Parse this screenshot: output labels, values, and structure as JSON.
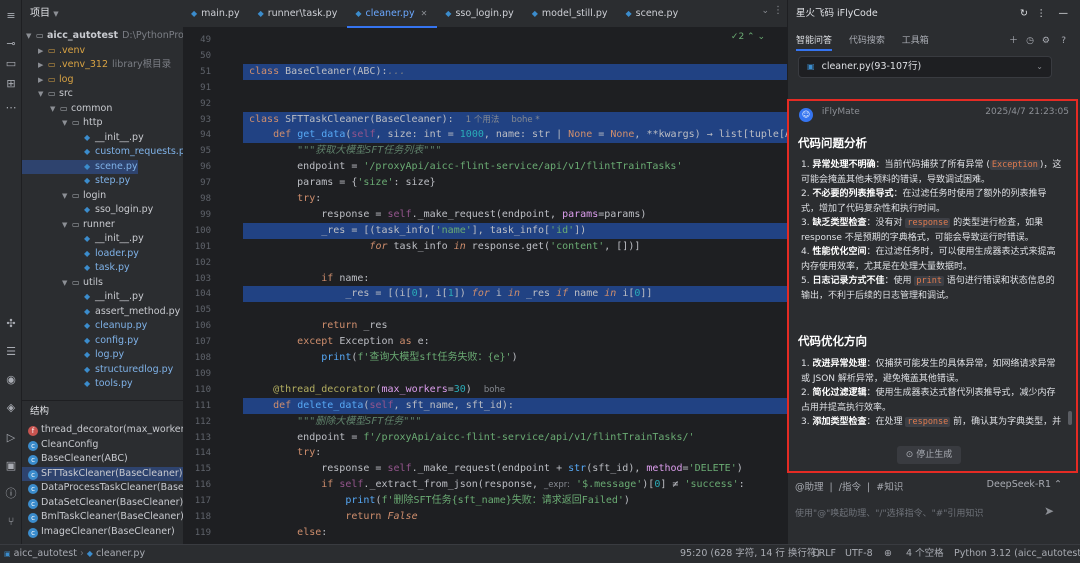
{
  "project": {
    "title": "项目",
    "tree": [
      {
        "label": "aicc_autotest",
        "extra": "D:\\PythonProje",
        "kind": "folder",
        "depth": 0,
        "open": true
      },
      {
        "label": ".venv",
        "kind": "folder",
        "depth": 1,
        "open": false
      },
      {
        "label": ".venv_312",
        "extra": "library根目录",
        "kind": "folder",
        "depth": 1,
        "open": false
      },
      {
        "label": "log",
        "kind": "folder",
        "depth": 1,
        "open": false
      },
      {
        "label": "src",
        "kind": "folder",
        "depth": 1,
        "open": true
      },
      {
        "label": "common",
        "kind": "folder",
        "depth": 2,
        "open": true
      },
      {
        "label": "http",
        "kind": "folder",
        "depth": 3,
        "open": true
      },
      {
        "label": "__init__.py",
        "kind": "py",
        "depth": 4
      },
      {
        "label": "custom_requests.p",
        "kind": "py",
        "depth": 4
      },
      {
        "label": "scene.py",
        "kind": "py",
        "depth": 4
      },
      {
        "label": "step.py",
        "kind": "py",
        "depth": 4
      },
      {
        "label": "login",
        "kind": "folder",
        "depth": 3,
        "open": true
      },
      {
        "label": "sso_login.py",
        "kind": "py",
        "depth": 4
      },
      {
        "label": "runner",
        "kind": "folder",
        "depth": 3,
        "open": true
      },
      {
        "label": "__init__.py",
        "kind": "py",
        "depth": 4
      },
      {
        "label": "loader.py",
        "kind": "py",
        "depth": 4
      },
      {
        "label": "task.py",
        "kind": "py",
        "depth": 4
      },
      {
        "label": "utils",
        "kind": "folder",
        "depth": 3,
        "open": true
      },
      {
        "label": "__init__.py",
        "kind": "py",
        "depth": 4
      },
      {
        "label": "assert_method.py",
        "kind": "py",
        "depth": 4
      },
      {
        "label": "cleanup.py",
        "kind": "py",
        "depth": 4
      },
      {
        "label": "config.py",
        "kind": "py",
        "depth": 4
      },
      {
        "label": "log.py",
        "kind": "py",
        "depth": 4
      },
      {
        "label": "structuredlog.py",
        "kind": "py",
        "depth": 4
      },
      {
        "label": "tools.py",
        "kind": "py",
        "depth": 4
      }
    ]
  },
  "structure": {
    "title": "结构",
    "items": [
      {
        "label": "thread_decorator(max_worker",
        "kind": "f",
        "color": "#c75450"
      },
      {
        "label": "CleanConfig",
        "kind": "c",
        "color": "#3b8ccc"
      },
      {
        "label": "BaseCleaner(ABC)",
        "kind": "c",
        "color": "#3b8ccc"
      },
      {
        "label": "SFTTaskCleaner(BaseCleaner)",
        "kind": "c",
        "color": "#3b8ccc",
        "selected": true
      },
      {
        "label": "DataProcessTaskCleaner(BaseC",
        "kind": "c",
        "color": "#3b8ccc"
      },
      {
        "label": "DataSetCleaner(BaseCleaner)",
        "kind": "c",
        "color": "#3b8ccc"
      },
      {
        "label": "BmlTaskCleaner(BaseCleaner)",
        "kind": "c",
        "color": "#3b8ccc"
      },
      {
        "label": "ImageCleaner(BaseCleaner)",
        "kind": "c",
        "color": "#3b8ccc"
      }
    ]
  },
  "tabs": [
    {
      "label": "main.py",
      "active": false
    },
    {
      "label": "runner\\task.py",
      "active": false
    },
    {
      "label": "cleaner.py",
      "active": true
    },
    {
      "label": "sso_login.py",
      "active": false
    },
    {
      "label": "model_still.py",
      "active": false
    },
    {
      "label": "scene.py",
      "active": false
    }
  ],
  "editor": {
    "inspection": "2",
    "hint_usages": "1 个用法",
    "hint_author": "bohe *",
    "hint_author2": "bohe"
  },
  "ai": {
    "title": "星火飞码 iFlyCode",
    "tabs": [
      "智能问答",
      "代码搜索",
      "工具箱"
    ],
    "context_file": "cleaner.py(93-107行)",
    "bot_name": "iFlyMate",
    "timestamp": "2025/4/7 21:23:05",
    "section1": "代码问题分析",
    "analysis": [
      {
        "title": "异常处理不明确",
        "pre": "：当前代码捕获了所有异常 (",
        "code": "Exception",
        "post": ")，这可能会掩盖其他未预料的错误，导致调试困难。"
      },
      {
        "title": "不必要的列表推导式",
        "pre": "：在过滤任务时使用了额外的列表推导式，增加了代码复杂性和执行时间。",
        "code": "",
        "post": ""
      },
      {
        "title": "缺乏类型检查",
        "pre": "：没有对 ",
        "code": "response",
        "post": " 的类型进行检查，如果 response 不是预期的字典格式，可能会导致运行时错误。"
      },
      {
        "title": "性能优化空间",
        "pre": "：在过滤任务时，可以使用生成器表达式来提高内存使用效率，尤其是在处理大量数据时。",
        "code": "",
        "post": ""
      },
      {
        "title": "日志记录方式不佳",
        "pre": "：使用 ",
        "code": "print",
        "post": " 语句进行错误和状态信息的输出，不利于后续的日志管理和调试。"
      }
    ],
    "section2": "代码优化方向",
    "optimize": [
      {
        "title": "改进异常处理",
        "pre": "：仅捕获可能发生的具体异常，如网络请求异常或 JSON 解析异常，避免掩盖其他错误。",
        "code": "",
        "post": ""
      },
      {
        "title": "简化过滤逻辑",
        "pre": "：使用生成器表达式替代列表推导式，减少内存占用并提高执行效率。",
        "code": "",
        "post": ""
      },
      {
        "title": "添加类型检查",
        "pre": "：在处理 ",
        "code": "response",
        "post": " 前，确认其为字典类型，并记录错误信息。"
      }
    ],
    "stop_label": "停止生成",
    "input_tags": [
      "@助理",
      "/指令",
      "#知识"
    ],
    "model": "DeepSeek-R1",
    "placeholder": "使用\"@\"唤起助理、\"/\"选择指令、\"#\"引用知识"
  },
  "status": {
    "breadcrumb1": "aicc_autotest",
    "breadcrumb2": "cleaner.py",
    "position": "95:20 (628 字符, 14 行 换行符)",
    "line_sep": "CRLF",
    "encoding": "UTF-8",
    "indent": "4 个空格",
    "interpreter": "Python 3.12 (aicc_autotest)"
  }
}
